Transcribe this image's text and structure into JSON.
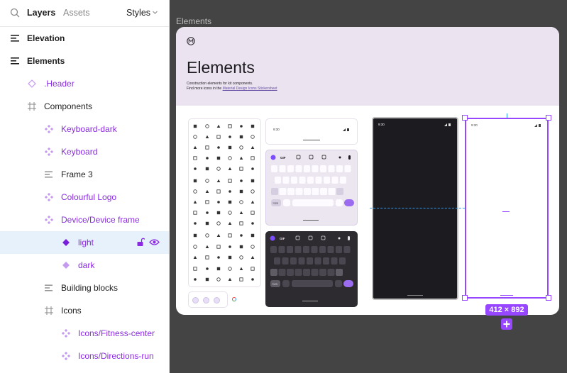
{
  "panel": {
    "tab_layers": "Layers",
    "tab_assets": "Assets",
    "styles_label": "Styles"
  },
  "layers": [
    {
      "name": "Elevation",
      "icon": "text-frame-icon"
    },
    {
      "name": "Elements",
      "icon": "text-frame-icon"
    },
    {
      "name": ".Header",
      "icon": "component-set-icon"
    },
    {
      "name": "Components",
      "icon": "frame-grid-icon"
    },
    {
      "name": "Keyboard-dark",
      "icon": "instance-icon"
    },
    {
      "name": "Keyboard",
      "icon": "instance-icon"
    },
    {
      "name": "Frame 3",
      "icon": "auto-layout-icon"
    },
    {
      "name": "Colourful Logo",
      "icon": "instance-icon"
    },
    {
      "name": "Device/Device frame",
      "icon": "instance-icon"
    },
    {
      "name": "light",
      "icon": "variant-icon",
      "selected": true
    },
    {
      "name": "dark",
      "icon": "variant-icon"
    },
    {
      "name": "Building blocks",
      "icon": "auto-layout-icon"
    },
    {
      "name": "Icons",
      "icon": "frame-grid-icon"
    },
    {
      "name": "Icons/Fitness-center",
      "icon": "instance-icon"
    },
    {
      "name": "Icons/Directions-run",
      "icon": "instance-icon"
    }
  ],
  "canvas": {
    "frame_label": "Elements",
    "title": "Elements",
    "desc_line1": "Construction elements for kit components.",
    "desc_line2_prefix": "Find more icons in the ",
    "desc_link": "Material Design Icons Stickersheet",
    "status_time": "9:30",
    "selection_size": "412 × 892",
    "keyboard_key_label": "GIF",
    "keyboard_sym_label": "?123"
  },
  "colors": {
    "accent": "#9747ff",
    "header_bg": "#ebe3f0",
    "component_purple": "#8a2be2",
    "selection_row": "#e6f1fb",
    "canvas_bg": "#444444"
  }
}
